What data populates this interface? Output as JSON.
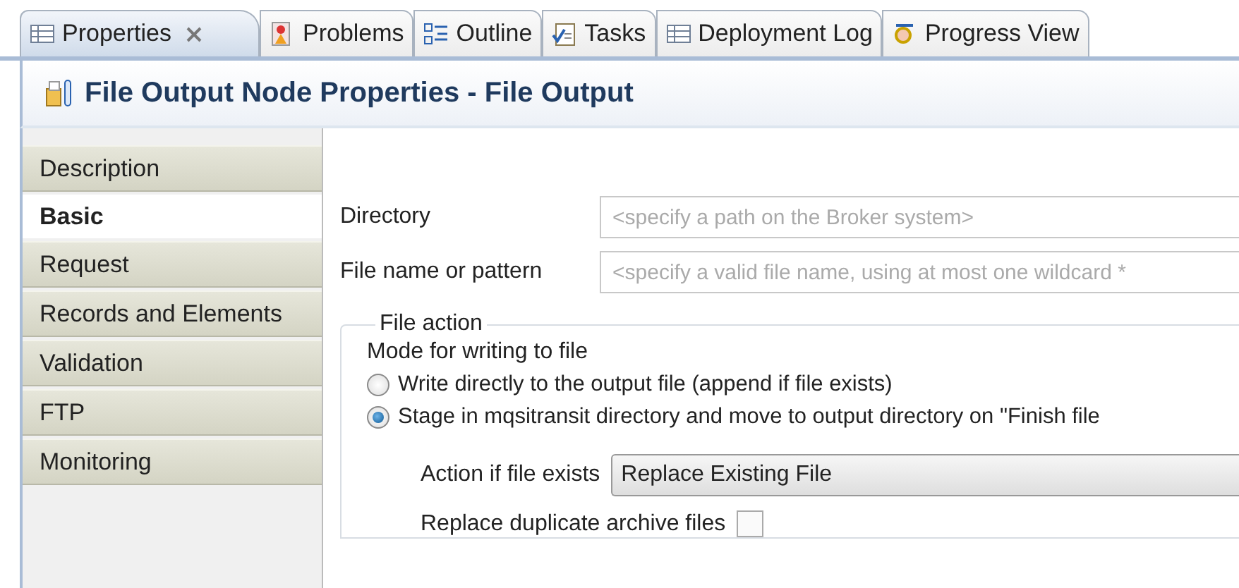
{
  "tabs": [
    {
      "label": "Properties",
      "kind": "table",
      "selected": true,
      "closable": true
    },
    {
      "label": "Problems",
      "kind": "problems",
      "selected": false,
      "closable": false
    },
    {
      "label": "Outline",
      "kind": "outline",
      "selected": false,
      "closable": false
    },
    {
      "label": "Tasks",
      "kind": "tasks",
      "selected": false,
      "closable": false
    },
    {
      "label": "Deployment Log",
      "kind": "table",
      "selected": false,
      "closable": false
    },
    {
      "label": "Progress View",
      "kind": "progress",
      "selected": false,
      "closable": false
    }
  ],
  "header": {
    "title": "File Output Node Properties - File Output"
  },
  "sidebar": {
    "items": [
      {
        "label": "Description",
        "selected": false
      },
      {
        "label": "Basic",
        "selected": true
      },
      {
        "label": "Request",
        "selected": false
      },
      {
        "label": "Records and Elements",
        "selected": false
      },
      {
        "label": "Validation",
        "selected": false
      },
      {
        "label": "FTP",
        "selected": false
      },
      {
        "label": "Monitoring",
        "selected": false
      }
    ]
  },
  "fields": [
    {
      "label": "Directory",
      "placeholder": "<specify a path on the Broker system>"
    },
    {
      "label": "File name or pattern",
      "placeholder": "<specify a valid file name, using at most one wildcard *"
    }
  ],
  "file_action": {
    "title": "File action",
    "mode_label": "Mode for writing to file",
    "options": [
      {
        "label": "Write directly to the output file (append if file exists)",
        "selected": false
      },
      {
        "label": "Stage in mqsitransit directory and move to output directory on \"Finish file",
        "selected": true
      }
    ],
    "action_label": "Action if file exists",
    "action_value": "Replace Existing File",
    "replace_label": "Replace duplicate archive files",
    "replace_checked": false
  }
}
